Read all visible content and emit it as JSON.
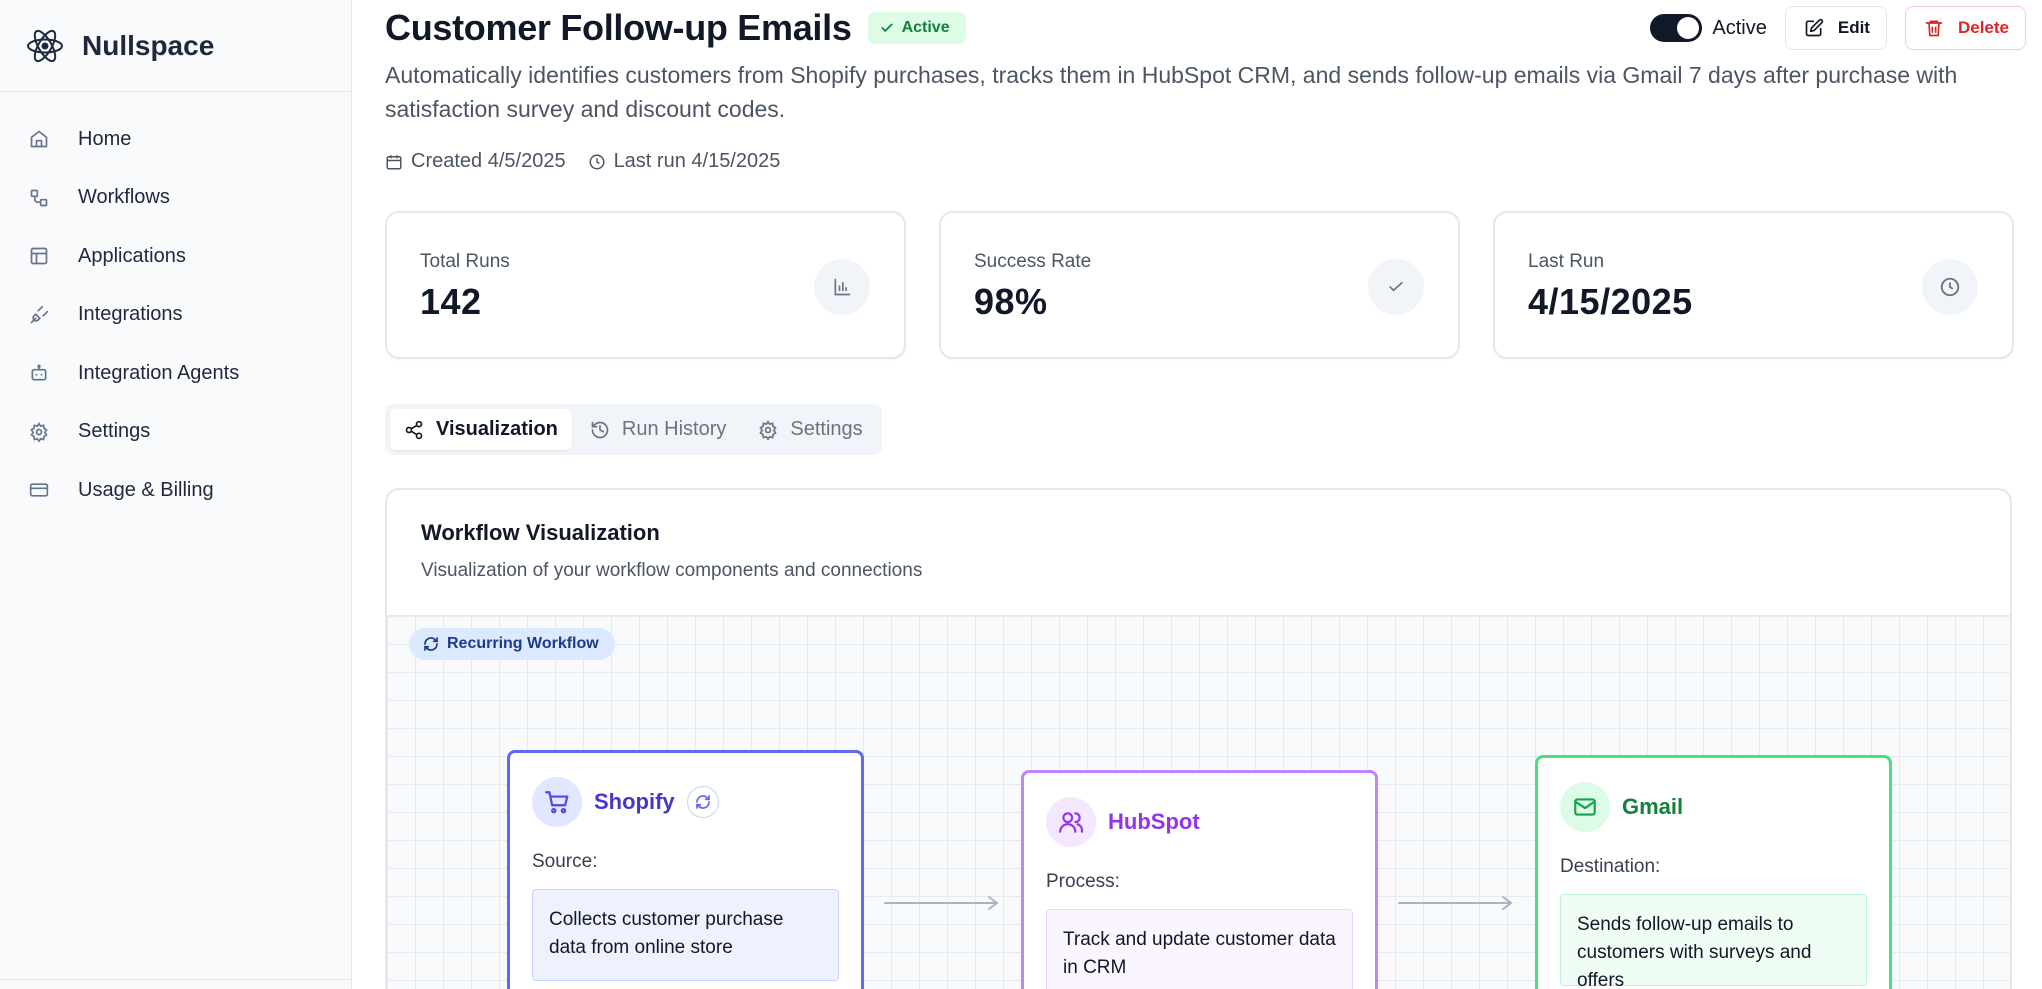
{
  "app": {
    "name": "Nullspace",
    "logo_icon": "atom-logo-icon"
  },
  "sidebar": {
    "items": [
      {
        "label": "Home",
        "icon": "home-icon"
      },
      {
        "label": "Workflows",
        "icon": "workflow-icon"
      },
      {
        "label": "Applications",
        "icon": "layout-icon"
      },
      {
        "label": "Integrations",
        "icon": "plug-icon"
      },
      {
        "label": "Integration Agents",
        "icon": "bot-icon"
      },
      {
        "label": "Settings",
        "icon": "gear-icon"
      },
      {
        "label": "Usage & Billing",
        "icon": "credit-card-icon"
      }
    ]
  },
  "header": {
    "title": "Customer Follow-up Emails",
    "status": "Active",
    "toggle_label": "Active",
    "toggle_on": true,
    "edit_label": "Edit",
    "delete_label": "Delete",
    "description": "Automatically identifies customers from Shopify purchases, tracks them in HubSpot CRM, and sends follow-up emails via Gmail 7 days after purchase with satisfaction survey and discount codes.",
    "created": "Created 4/5/2025",
    "last_run": "Last run 4/15/2025"
  },
  "stats": [
    {
      "label": "Total Runs",
      "value": "142",
      "icon": "bar-chart-icon"
    },
    {
      "label": "Success Rate",
      "value": "98%",
      "icon": "check-icon"
    },
    {
      "label": "Last Run",
      "value": "4/15/2025",
      "icon": "clock-icon"
    }
  ],
  "tabs": [
    {
      "label": "Visualization",
      "icon": "share-icon",
      "active": true
    },
    {
      "label": "Run History",
      "icon": "history-icon",
      "active": false
    },
    {
      "label": "Settings",
      "icon": "gear-icon",
      "active": false
    }
  ],
  "visualization": {
    "title": "Workflow Visualization",
    "subtitle": "Visualization of your workflow components and connections",
    "chip": "Recurring Workflow",
    "nodes": [
      {
        "name": "Shopify",
        "role": "Source:",
        "description": "Collects customer purchase data from online store",
        "icon": "cart-icon",
        "color": "#6366f1"
      },
      {
        "name": "HubSpot",
        "role": "Process:",
        "description": "Track and update customer data in CRM",
        "icon": "users-icon",
        "color": "#c084fc"
      },
      {
        "name": "Gmail",
        "role": "Destination:",
        "description": "Sends follow-up emails to customers with surveys and offers",
        "icon": "mail-icon",
        "color": "#4ade80"
      }
    ]
  }
}
